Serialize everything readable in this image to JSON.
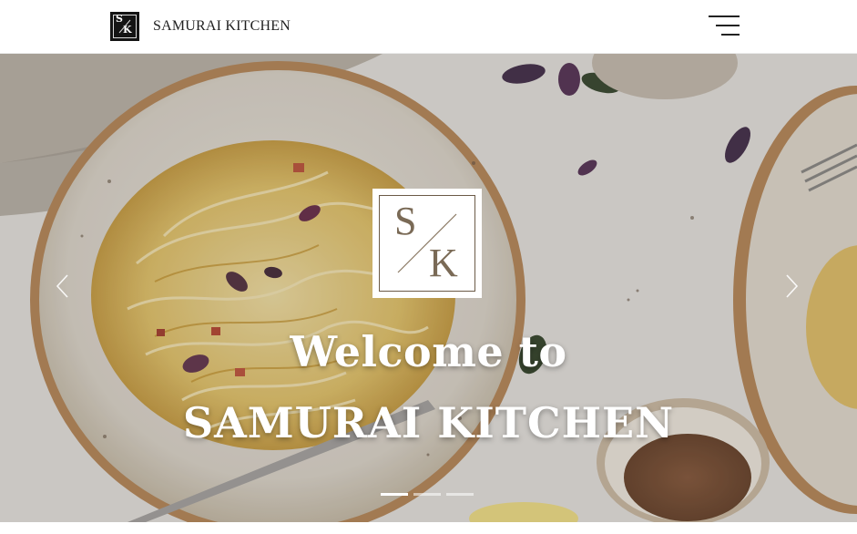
{
  "header": {
    "brand_initials_top": "S",
    "brand_initials_bottom": "K",
    "brand_name": "SAMURAI KITCHEN",
    "menu_icon": "hamburger-menu-icon"
  },
  "hero": {
    "logo_letter_top": "S",
    "logo_letter_bottom": "K",
    "title_line1": "Welcome to",
    "title_line2": "SAMURAI KITCHEN",
    "prev_icon": "chevron-left-icon",
    "next_icon": "chevron-right-icon",
    "slides_total": 3,
    "active_slide": 1
  },
  "colors": {
    "header_bg": "#ffffff",
    "logo_dark": "#141414",
    "hero_logo_text": "#7a6a56",
    "hero_text": "#ffffff"
  }
}
